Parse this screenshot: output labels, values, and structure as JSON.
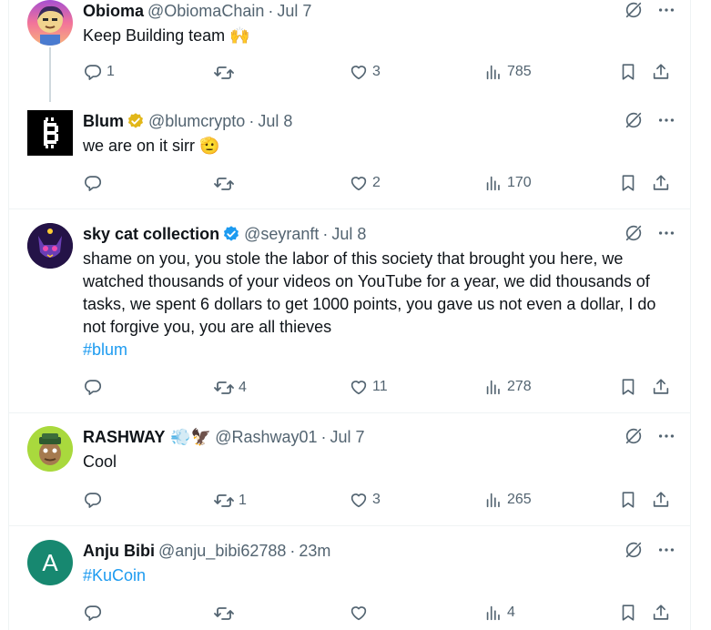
{
  "tweets": [
    {
      "name": "Obioma",
      "handle": "@ObiomaChain",
      "time": "Jul 7",
      "text": "Keep Building team 🙌",
      "hashtag": "",
      "replies": "1",
      "retweets": "",
      "likes": "3",
      "views": "785",
      "verified": false
    },
    {
      "name": "Blum",
      "handle": "@blumcrypto",
      "time": "Jul 8",
      "text": "we are on it sirr 🫡",
      "hashtag": "",
      "replies": "",
      "retweets": "",
      "likes": "2",
      "views": "170",
      "verified": true,
      "verified_color": "#e2b719"
    },
    {
      "name": "sky cat collection",
      "handle": "@seyranft",
      "time": "Jul 8",
      "text": "shame on you, you stole the labor of this society that brought you here, we watched thousands of your videos on YouTube for a year, we did thousands of tasks, we spent 6 dollars to get 1000 points, you gave us not even a dollar, I do not forgive you, you are all thieves",
      "hashtag": "#blum",
      "replies": "",
      "retweets": "4",
      "likes": "11",
      "views": "278",
      "verified": true,
      "verified_color": "#1d9bf0"
    },
    {
      "name": "RASHWAY",
      "name_emoji": "💨🦅",
      "handle": "@Rashway01",
      "time": "Jul 7",
      "text": "Cool",
      "hashtag": "",
      "replies": "",
      "retweets": "1",
      "likes": "3",
      "views": "265",
      "verified": false
    },
    {
      "name": "Anju Bibi",
      "handle": "@anju_bibi62788",
      "time": "23m",
      "text": "",
      "hashtag": "#KuCoin",
      "replies": "",
      "retweets": "",
      "likes": "",
      "views": "4",
      "verified": false,
      "avatar_letter": "A"
    }
  ],
  "separator": "·",
  "icons": [
    "grok-icon",
    "more-icon",
    "reply-icon",
    "retweet-icon",
    "like-icon",
    "views-icon",
    "bookmark-icon",
    "share-icon"
  ],
  "colors": {
    "link": "#1d9bf0",
    "muted": "#536471",
    "gold_badge": "#e2b719",
    "blue_badge": "#1d9bf0",
    "blum_avatar": "#000000",
    "anju_avatar": "#178870"
  }
}
